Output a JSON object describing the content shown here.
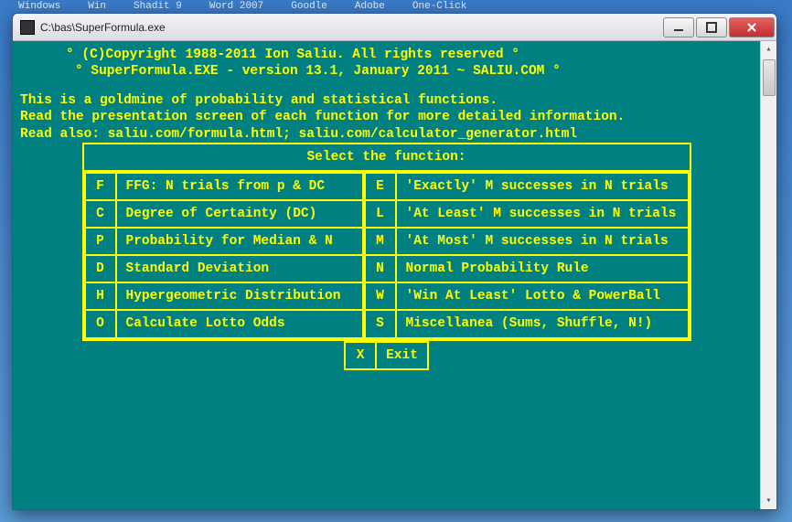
{
  "taskbar": [
    "Windows",
    "Win",
    "Shadit 9",
    "Word 2007",
    "Goodle",
    "Adobe",
    "One-Click"
  ],
  "window": {
    "title": "C:\\bas\\SuperFormula.exe"
  },
  "console": {
    "copyright": "° (C)Copyright 1988-2011 Ion Saliu. All rights reserved °",
    "version": "° SuperFormula.EXE - version 13.1, January 2011 ~ SALIU.COM °",
    "intro1": "This is a goldmine of probability and statistical functions.",
    "intro2": "Read the presentation screen of each function for more detailed information.",
    "intro3": "Read also: saliu.com/formula.html; saliu.com/calculator_generator.html",
    "menu_header": "Select the function:",
    "left": [
      {
        "key": "F",
        "desc": "FFG: N trials from p & DC"
      },
      {
        "key": "C",
        "desc": "Degree of Certainty (DC)"
      },
      {
        "key": "P",
        "desc": "Probability for Median & N"
      },
      {
        "key": "D",
        "desc": "Standard Deviation"
      },
      {
        "key": "H",
        "desc": "Hypergeometric Distribution"
      },
      {
        "key": "O",
        "desc": "Calculate Lotto Odds"
      }
    ],
    "right": [
      {
        "key": "E",
        "desc": "'Exactly' M successes in N trials"
      },
      {
        "key": "L",
        "desc": "'At Least' M successes in N trials"
      },
      {
        "key": "M",
        "desc": "'At Most' M successes in N trials"
      },
      {
        "key": "N",
        "desc": "Normal Probability Rule"
      },
      {
        "key": "W",
        "desc": "'Win At Least' Lotto & PowerBall"
      },
      {
        "key": "S",
        "desc": "Miscellanea (Sums, Shuffle, N!)"
      }
    ],
    "exit": {
      "key": "X",
      "desc": "Exit"
    }
  }
}
